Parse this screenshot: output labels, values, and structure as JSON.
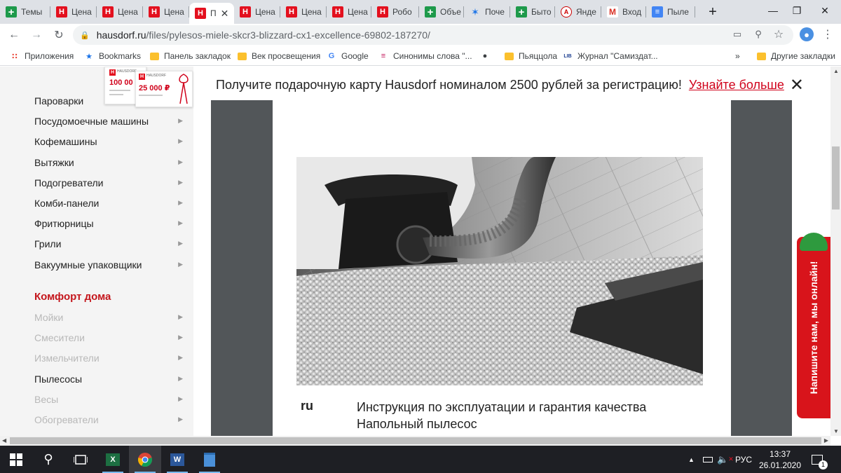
{
  "tabs": [
    {
      "label": "Темы",
      "favicon": "plus-green-icon",
      "active": false
    },
    {
      "label": "Цена",
      "favicon": "hausdorf-h-icon",
      "active": false
    },
    {
      "label": "Цена",
      "favicon": "hausdorf-h-icon",
      "active": false
    },
    {
      "label": "Цена",
      "favicon": "hausdorf-h-icon",
      "active": false
    },
    {
      "label": "П",
      "favicon": "hausdorf-h-icon",
      "active": true
    },
    {
      "label": "Цена",
      "favicon": "hausdorf-h-icon",
      "active": false
    },
    {
      "label": "Цена",
      "favicon": "hausdorf-h-icon",
      "active": false
    },
    {
      "label": "Цена",
      "favicon": "hausdorf-h-icon",
      "active": false
    },
    {
      "label": "Робо",
      "favicon": "hausdorf-h-icon",
      "active": false
    },
    {
      "label": "Объе",
      "favicon": "plus-green-icon",
      "active": false
    },
    {
      "label": "Поче",
      "favicon": "sparkle-icon",
      "active": false
    },
    {
      "label": "Быто",
      "favicon": "plus-green-icon",
      "active": false
    },
    {
      "label": "Янде",
      "favicon": "yandex-avatar-icon",
      "active": false
    },
    {
      "label": "Вход",
      "favicon": "mail-icon",
      "active": false
    },
    {
      "label": "Пыле",
      "favicon": "docs-icon",
      "active": false
    }
  ],
  "address": {
    "host": "hausdorf.ru",
    "path": "/files/pylesos-miele-skcr3-blizzard-cx1-excellence-69802-187270/"
  },
  "bookmarks": [
    {
      "label": "Приложения",
      "icon": "apps-grid-icon"
    },
    {
      "label": "Bookmarks",
      "icon": "star-icon"
    },
    {
      "label": "Панель закладок",
      "icon": "folder-icon"
    },
    {
      "label": "Век просвещения",
      "icon": "folder-icon"
    },
    {
      "label": "Google",
      "icon": "google-icon"
    },
    {
      "label": "Синонимы слова \"...",
      "icon": "synonyms-icon"
    },
    {
      "label": "",
      "icon": "globe-icon"
    },
    {
      "label": "Пьяццола",
      "icon": "folder-icon"
    },
    {
      "label": "Журнал \"Самиздат...",
      "icon": "lib-ru-icon"
    }
  ],
  "bookmarks_overflow": "»",
  "bookmarks_other": "Другие закладки",
  "sidebar": {
    "items_top": [
      {
        "label": "Пароварки",
        "disabled": false
      },
      {
        "label": "Посудомоечные машины",
        "disabled": false
      },
      {
        "label": "Кофемашины",
        "disabled": false
      },
      {
        "label": "Вытяжки",
        "disabled": false
      },
      {
        "label": "Подогреватели",
        "disabled": false
      },
      {
        "label": "Комби-панели",
        "disabled": false
      },
      {
        "label": "Фритюрницы",
        "disabled": false
      },
      {
        "label": "Грили",
        "disabled": false
      },
      {
        "label": "Вакуумные упаковщики",
        "disabled": false
      }
    ],
    "heading": "Комфорт дома",
    "items_bottom": [
      {
        "label": "Мойки",
        "disabled": true
      },
      {
        "label": "Смесители",
        "disabled": true
      },
      {
        "label": "Измельчители",
        "disabled": true
      },
      {
        "label": "Пылесосы",
        "disabled": false
      },
      {
        "label": "Весы",
        "disabled": true
      },
      {
        "label": "Обогреватели",
        "disabled": true
      }
    ]
  },
  "promo": {
    "text": "Получите подарочную карту Hausdorf номиналом 2500 рублей за регистрацию!",
    "link": "Узнайте больше",
    "card_brand": "HAUSDORF",
    "card_amount_1": "100 00",
    "card_amount_2": "25 000 ₽"
  },
  "document": {
    "lang": "ru",
    "title_line1": "Инструкция по эксплуатации и гарантия качества",
    "title_line2": "Напольный пылесос"
  },
  "chat": {
    "label": "Напишите нам, мы онлайн!"
  },
  "taskbar": {
    "language": "РУС",
    "time": "13:37",
    "date": "26.01.2020",
    "notifications": "1"
  },
  "colors": {
    "brand_red": "#d8141b",
    "heading_red": "#c4161c",
    "link_red": "#d0021b",
    "viewer_gray": "#525659"
  }
}
